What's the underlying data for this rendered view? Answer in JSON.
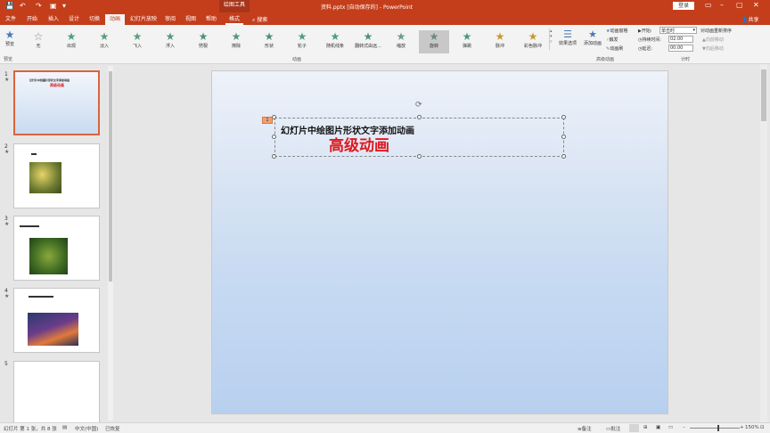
{
  "title_bar": {
    "context_tab": "绘图工具",
    "doc_title": "资料.pptx [自动保存的] - PowerPoint",
    "login": "登录",
    "share": "共享"
  },
  "tabs": [
    "文件",
    "开始",
    "插入",
    "设计",
    "切换",
    "动画",
    "幻灯片放映",
    "审阅",
    "视图",
    "帮助",
    "格式"
  ],
  "search_label": "搜索",
  "ribbon": {
    "preview_label": "预览",
    "animations": [
      "无",
      "出现",
      "淡入",
      "飞入",
      "浮入",
      "劈裂",
      "擦除",
      "形状",
      "轮子",
      "随机线条",
      "翻转式由远...",
      "缩放",
      "旋转",
      "弹跳",
      "脉冲",
      "彩色脉冲"
    ],
    "selected_animation": "旋转",
    "effect_options": "效果选项",
    "add_animation": "添加动画",
    "animation_pane": "动画窗格",
    "trigger": "触发",
    "animation_painter": "动画刷",
    "start_label": "开始:",
    "start_value": "单击时",
    "duration_label": "持续时间:",
    "duration_value": "02.00",
    "delay_label": "延迟:",
    "delay_value": "00.00",
    "reorder": "对动画重新排序",
    "move_earlier": "向前移动",
    "move_later": "向后移动",
    "groups": {
      "preview": "预览",
      "animation": "动画",
      "advanced": "高级动画",
      "timing": "计时"
    }
  },
  "slides_panel": {
    "numbers": [
      "1",
      "2",
      "3",
      "4",
      "5"
    ],
    "star": "★",
    "thumb1_title": "幻灯片中绘图片形状文字添加动画",
    "thumb1_sub": "高级动画"
  },
  "slide": {
    "line1": "幻灯片中绘图片形状文字添加动画",
    "line2": "高级动画",
    "anim_tag": "1"
  },
  "status": {
    "slide_info": "幻灯片 第 1 张，共 8 张",
    "language": "中文(中国)",
    "saved": "已恢复",
    "notes": "备注",
    "comments": "批注",
    "zoom": "150%"
  }
}
